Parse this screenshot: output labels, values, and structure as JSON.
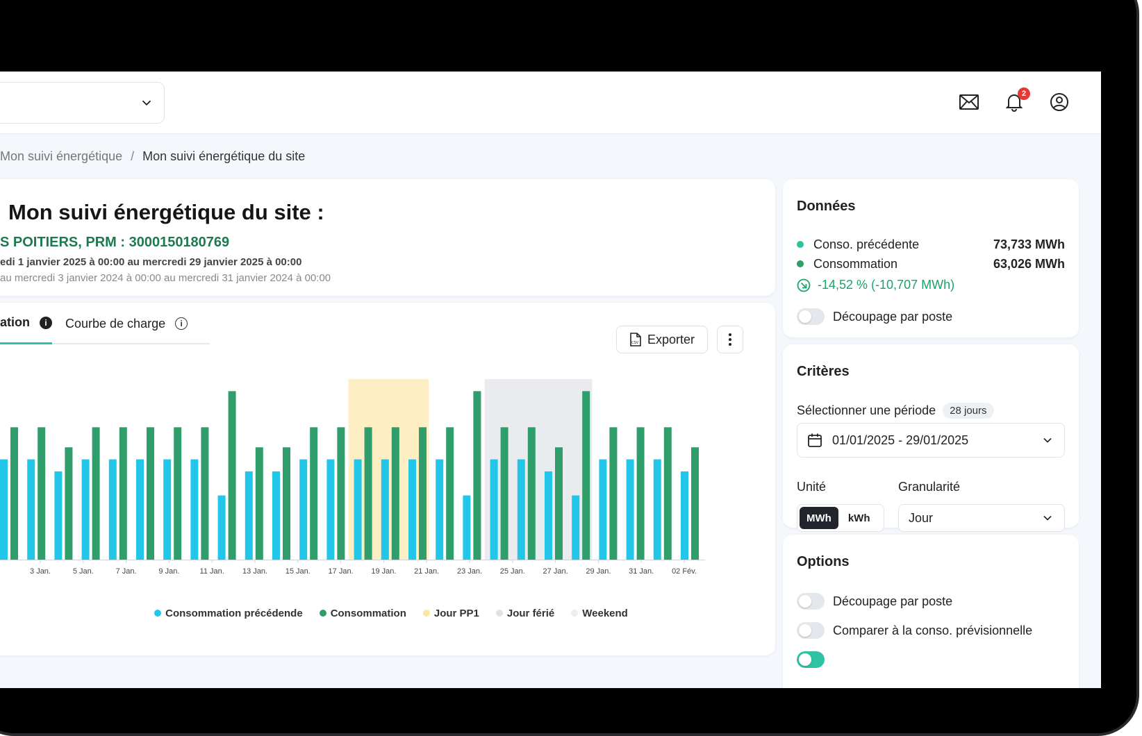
{
  "header": {
    "notification_count": "2"
  },
  "breadcrumb": {
    "parent": "Mon suivi énergétique",
    "separator": "/",
    "current": "Mon suivi énergétique du site"
  },
  "title_card": {
    "title": "Mon suivi énergétique du site :",
    "site": "S POITIERS, PRM : 3000150180769",
    "period": "edi 1 janvier 2025 à 00:00 au mercredi 29 janvier 2025 à 00:00",
    "reference_period": "au mercredi 3 janvier 2024 à 00:00 au mercredi 31 janvier 2024 à 00:00"
  },
  "chart_panel": {
    "tabs": [
      {
        "label": "ation",
        "active": true
      },
      {
        "label": "Courbe de charge",
        "active": false
      }
    ],
    "export_label": "Exporter",
    "export_badge": "CSV"
  },
  "colors": {
    "previous": "#22c6e8",
    "current": "#2f9e6b",
    "pp1": "#fdeec3",
    "holiday": "#e9ebee",
    "weekend": "#eef0f2",
    "accent": "#2ec3a3",
    "delta_green": "#1aa36b"
  },
  "chart_data": {
    "type": "bar",
    "x_tick_labels": [
      "3 Jan.",
      "5 Jan.",
      "7 Jan.",
      "9 Jan.",
      "11 Jan.",
      "13 Jan.",
      "15 Jan.",
      "17 Jan.",
      "19 Jan.",
      "21 Jan.",
      "23 Jan.",
      "25 Jan.",
      "27 Jan.",
      "29 Jan.",
      "31 Jan.",
      "02 Fév."
    ],
    "series": [
      {
        "name": "Consommation précédende",
        "values": [
          2.5,
          2.5,
          2.2,
          2.5,
          2.5,
          2.5,
          2.5,
          2.5,
          1.6,
          2.2,
          2.2,
          2.5,
          2.5,
          2.5,
          2.5,
          2.5,
          2.5,
          1.6,
          2.5,
          2.5,
          2.2,
          1.6,
          2.5,
          2.5,
          2.5,
          2.2
        ]
      },
      {
        "name": "Consommation",
        "values": [
          3.3,
          3.3,
          2.8,
          3.3,
          3.3,
          3.3,
          3.3,
          3.3,
          4.2,
          2.8,
          2.8,
          3.3,
          3.3,
          3.3,
          3.3,
          3.3,
          3.3,
          4.2,
          3.3,
          3.3,
          2.8,
          4.2,
          3.3,
          3.3,
          3.3,
          2.8
        ]
      }
    ],
    "bands": [
      {
        "type": "Jour PP1",
        "from_index": 13,
        "to_index": 15
      },
      {
        "type": "Weekend",
        "from_index": 18,
        "to_index": 21
      }
    ],
    "legend": [
      {
        "label": "Consommation précédende",
        "color": "#22c6e8"
      },
      {
        "label": "Consommation",
        "color": "#2f9e6b"
      },
      {
        "label": "Jour PP1",
        "color": "#fbe6a3"
      },
      {
        "label": "Jour férié",
        "color": "#dfe2e6"
      },
      {
        "label": "Weekend",
        "color": "#eceef1"
      }
    ],
    "ylim": [
      0,
      4.5
    ],
    "grid": false,
    "legend_position": "bottom"
  },
  "donnees": {
    "title": "Données",
    "rows": [
      {
        "label": "Conso. précédente",
        "value": "73,733 MWh",
        "color": "#2ec3a3"
      },
      {
        "label": "Consommation",
        "value": "63,026 MWh",
        "color": "#2f9e6b"
      }
    ],
    "delta": "-14,52 % (-10,707 MWh)",
    "toggle_label": "Découpage par poste"
  },
  "criteres": {
    "title": "Critères",
    "period_label": "Sélectionner une période",
    "period_badge": "28 jours",
    "period_value": "01/01/2025 - 29/01/2025",
    "unit_label": "Unité",
    "unit_options": [
      "MWh",
      "kWh"
    ],
    "unit_selected": "MWh",
    "granularity_label": "Granularité",
    "granularity_value": "Jour"
  },
  "options": {
    "title": "Options",
    "toggles": [
      {
        "label": "Découpage par poste",
        "on": false
      },
      {
        "label": "Comparer à la conso. prévisionnelle",
        "on": false
      }
    ]
  }
}
